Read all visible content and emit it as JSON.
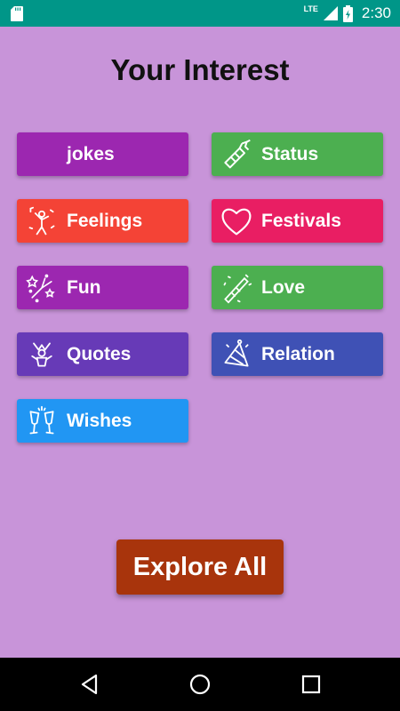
{
  "status_bar": {
    "network": "LTE",
    "time": "2:30",
    "icons": [
      "sd-card-icon",
      "signal-icon",
      "battery-charging-icon"
    ]
  },
  "title": "Your Interest",
  "interests": [
    {
      "label": "jokes",
      "color": "#9c27b0",
      "icon": "none"
    },
    {
      "label": "Status",
      "color": "#4caf50",
      "icon": "firecracker-icon"
    },
    {
      "label": "Feelings",
      "color": "#f44336",
      "icon": "dancing-person-icon"
    },
    {
      "label": "Festivals",
      "color": "#e91e63",
      "icon": "heart-icon"
    },
    {
      "label": "Fun",
      "color": "#9c27b0",
      "icon": "fireworks-icon"
    },
    {
      "label": "Love",
      "color": "#4caf50",
      "icon": "party-horn-icon"
    },
    {
      "label": "Quotes",
      "color": "#673ab7",
      "icon": "jester-icon"
    },
    {
      "label": "Relation",
      "color": "#3f51b5",
      "icon": "party-hat-icon"
    },
    {
      "label": "Wishes",
      "color": "#2196f3",
      "icon": "champagne-glasses-icon"
    }
  ],
  "explore_button": {
    "label": "Explore All",
    "color": "#a8340c"
  },
  "nav_bar": {
    "icons": [
      "back-icon",
      "home-icon",
      "recents-icon"
    ]
  }
}
